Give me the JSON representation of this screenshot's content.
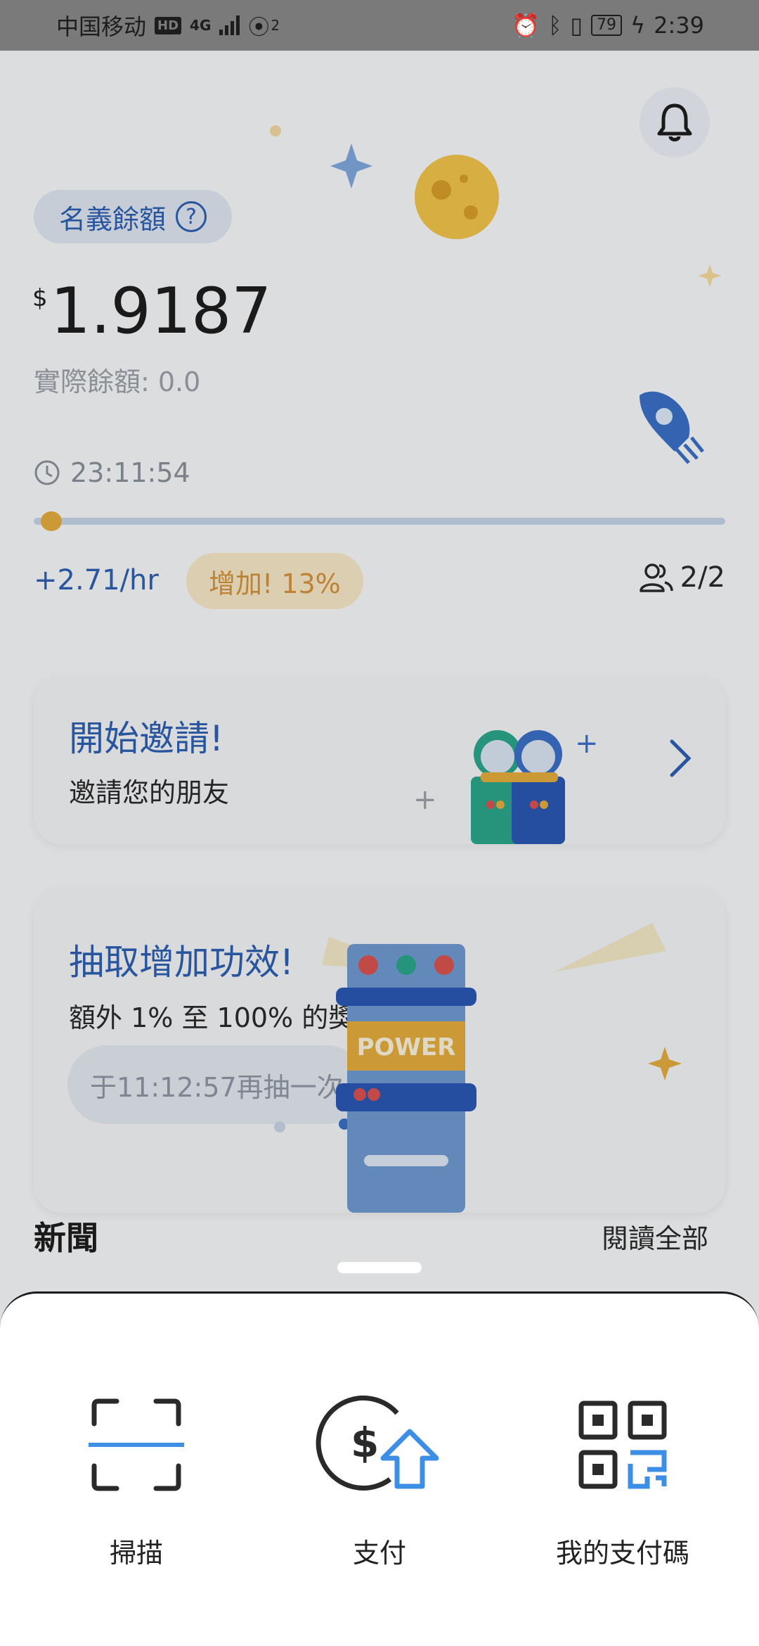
{
  "status_bar": {
    "carrier": "中国移动",
    "hd": "HD",
    "network": "4G",
    "hotspot_count": "2",
    "battery": "79",
    "time": "2:39"
  },
  "balance": {
    "nominal_label": "名義餘額",
    "currency": "$",
    "amount": "1.9187",
    "actual_label": "實際餘額: 0.0",
    "timer": "23:11:54",
    "progress": 0.01,
    "rate": "+2.71/hr",
    "boost_badge": "增加! 13%",
    "members": "2/2"
  },
  "invite_card": {
    "title": "開始邀請!",
    "subtitle": "邀請您的朋友"
  },
  "boost_card": {
    "title": "抽取增加功效!",
    "subtitle": "額外 1% 至 100% 的獎金率",
    "retry_button": "于11:12:57再抽一次",
    "machine_label": "POWER"
  },
  "news": {
    "title": "新聞",
    "read_all": "閱讀全部"
  },
  "sheet": {
    "actions": [
      {
        "label": "掃描",
        "icon": "scan-icon"
      },
      {
        "label": "支付",
        "icon": "pay-icon"
      },
      {
        "label": "我的支付碼",
        "icon": "qr-code-icon"
      }
    ]
  },
  "colors": {
    "primary": "#2d5fb0",
    "accent": "#e3ab3b",
    "sheet_blue": "#3d8fe6"
  }
}
